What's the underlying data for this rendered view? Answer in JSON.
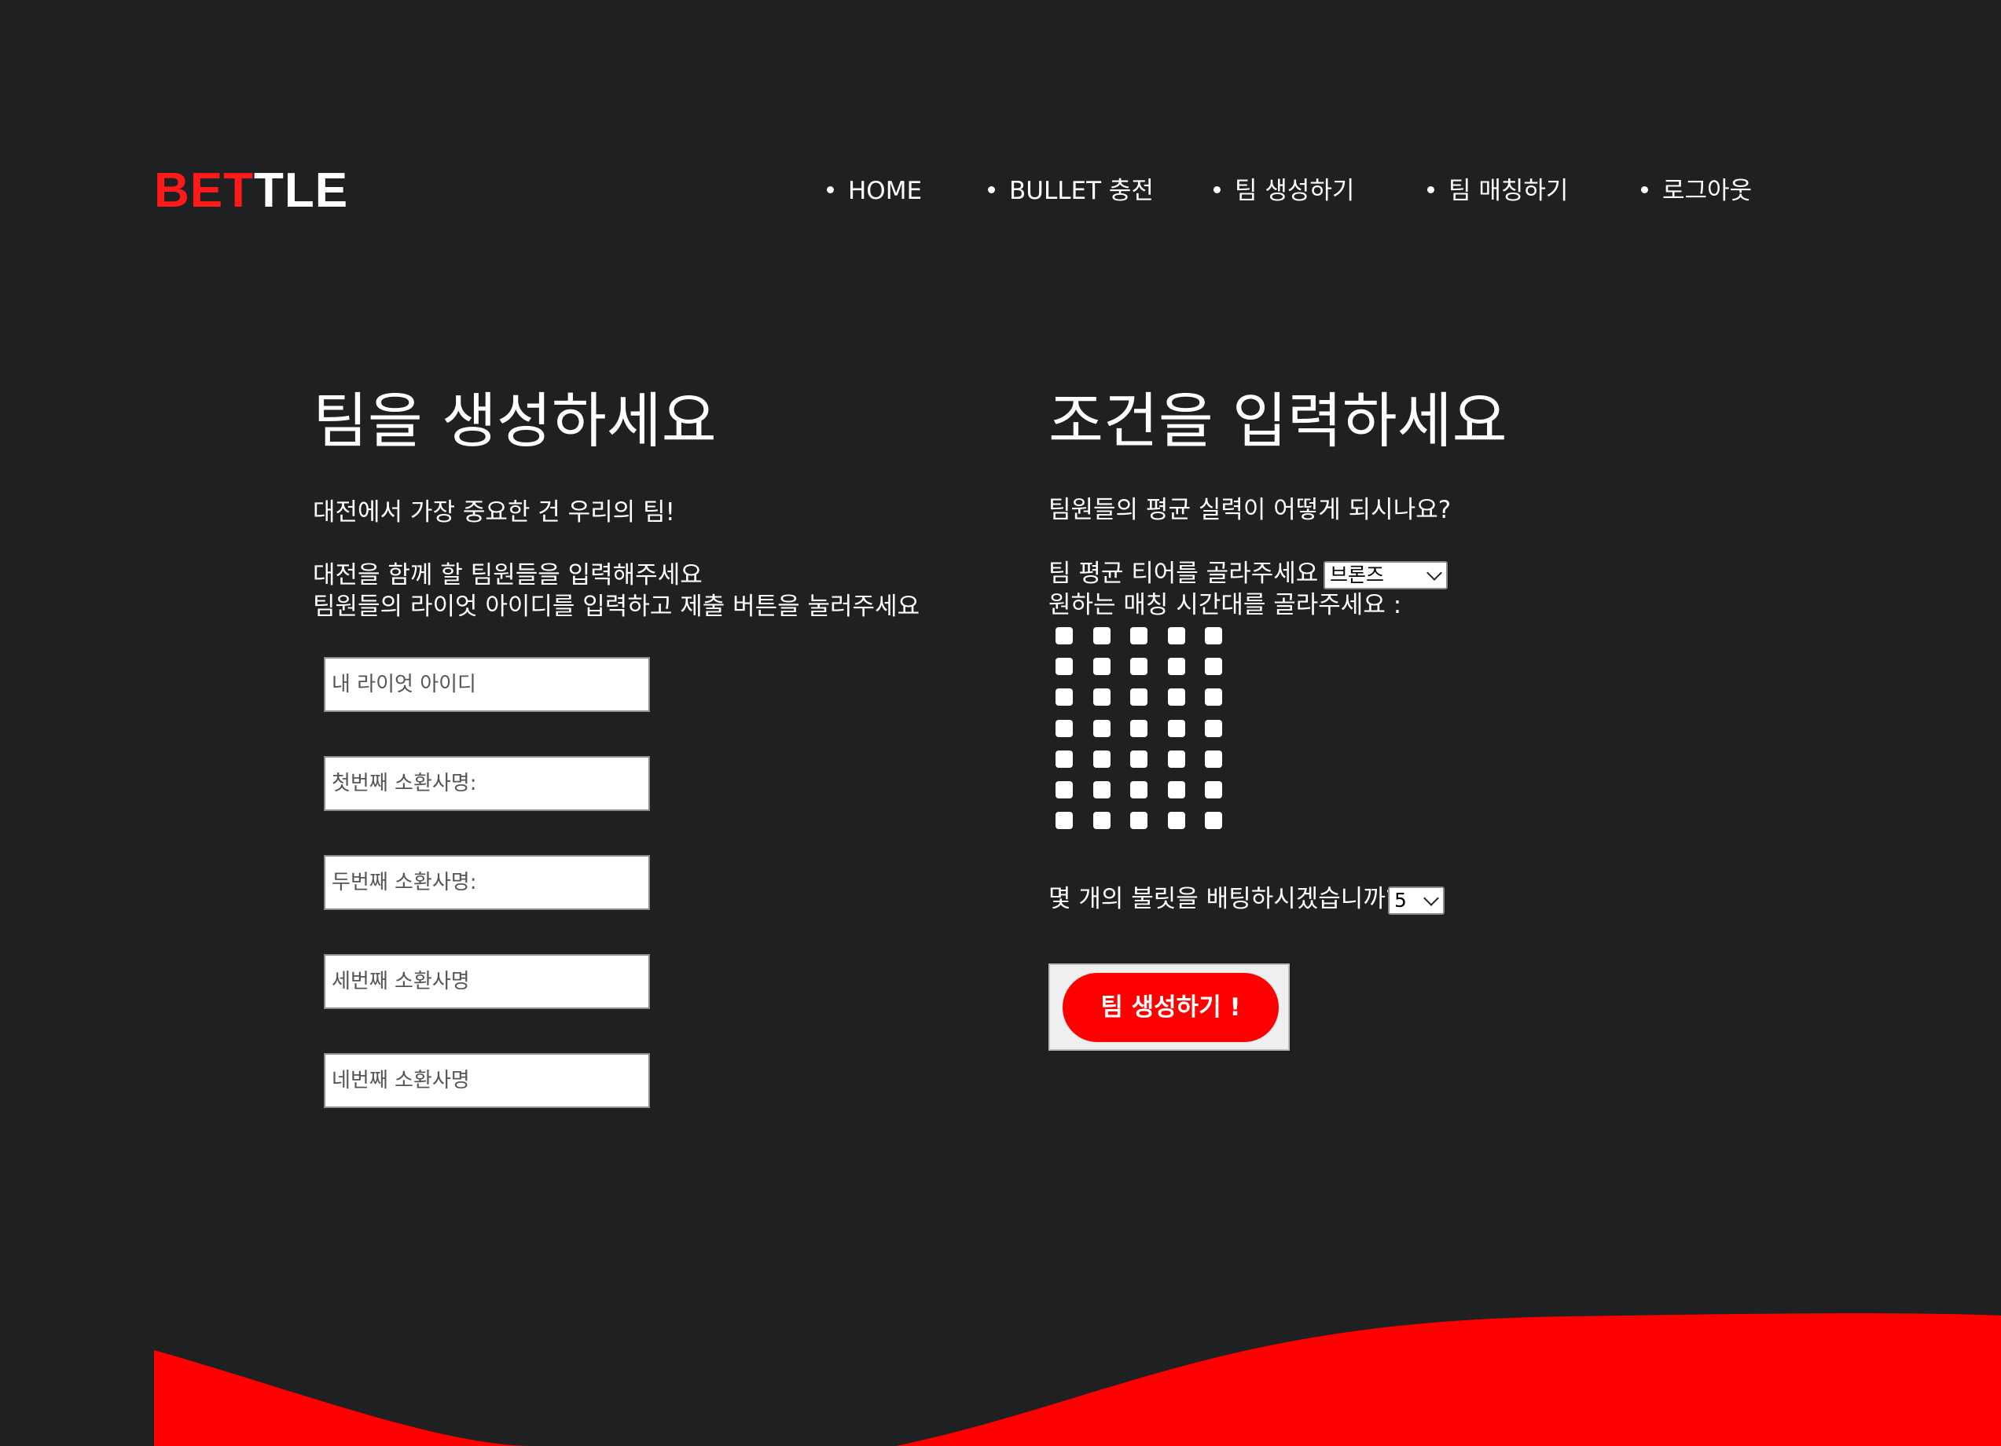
{
  "brand": {
    "part1": "BET",
    "part2": "TLE",
    "accent_color": "#ff1a1a"
  },
  "nav": {
    "items": [
      {
        "label": "HOME"
      },
      {
        "label": "BULLET 충전"
      },
      {
        "label": "팀 생성하기"
      },
      {
        "label": "팀 매칭하기"
      },
      {
        "label": "로그아웃"
      }
    ]
  },
  "left": {
    "heading": "팀을 생성하세요",
    "line1": "대전에서 가장 중요한 건 우리의 팀!",
    "line2": "대전을 함께 할 팀원들을 입력해주세요",
    "line3": "팀원들의 라이엇 아이디를 입력하고 제출 버튼을 눌러주세요",
    "fields": [
      {
        "placeholder": "내 라이엇 아이디",
        "value": ""
      },
      {
        "placeholder": "첫번째 소환사명:",
        "value": ""
      },
      {
        "placeholder": "두번째 소환사명:",
        "value": ""
      },
      {
        "placeholder": "세번째 소환사명",
        "value": ""
      },
      {
        "placeholder": "네번째 소환사명",
        "value": ""
      }
    ]
  },
  "right": {
    "heading": "조건을 입력하세요",
    "question": "팀원들의 평균 실력이 어떻게 되시나요?",
    "tier_label": "팀 평균 티어를 골라주세요 :",
    "tier_selected": "브론즈",
    "time_label": "원하는 매칭 시간대를 골라주세요 :",
    "time_checkboxes": {
      "rows": 7,
      "cols": 5,
      "checked": 0
    },
    "bet_label": "몇 개의 불릿을 배팅하시겠습니까?",
    "bet_selected": "5",
    "submit_label": "팀 생성하기 !"
  }
}
